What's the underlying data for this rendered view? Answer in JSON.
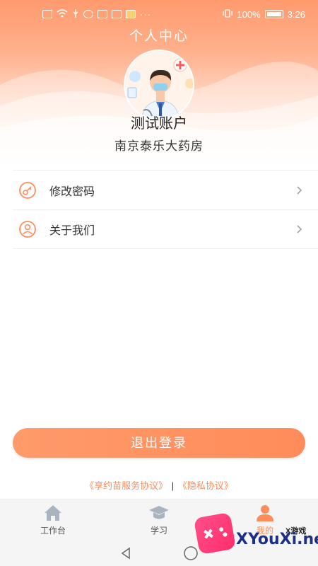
{
  "status_bar": {
    "battery_percent": "100%",
    "time": "3:26"
  },
  "header": {
    "title": "个人中心"
  },
  "profile": {
    "account_name": "测试账户",
    "store_name": "南京泰乐大药房"
  },
  "menu": {
    "items": [
      {
        "label": "修改密码",
        "icon": "key-icon"
      },
      {
        "label": "关于我们",
        "icon": "user-icon"
      }
    ]
  },
  "logout": {
    "label": "退出登录"
  },
  "agreements": {
    "service": "《享约苗服务协议》",
    "separator": "|",
    "privacy": "《隐私协议》"
  },
  "tabbar": {
    "items": [
      {
        "label": "工作台",
        "icon": "home-icon"
      },
      {
        "label": "学习",
        "icon": "graduation-cap-icon"
      },
      {
        "label": "我的",
        "icon": "person-icon"
      }
    ]
  },
  "watermark": {
    "sub": "X游戏",
    "text": "XYouXi.net"
  },
  "colors": {
    "accent": "#ff8c5a",
    "header_top": "#ff9a6e"
  }
}
